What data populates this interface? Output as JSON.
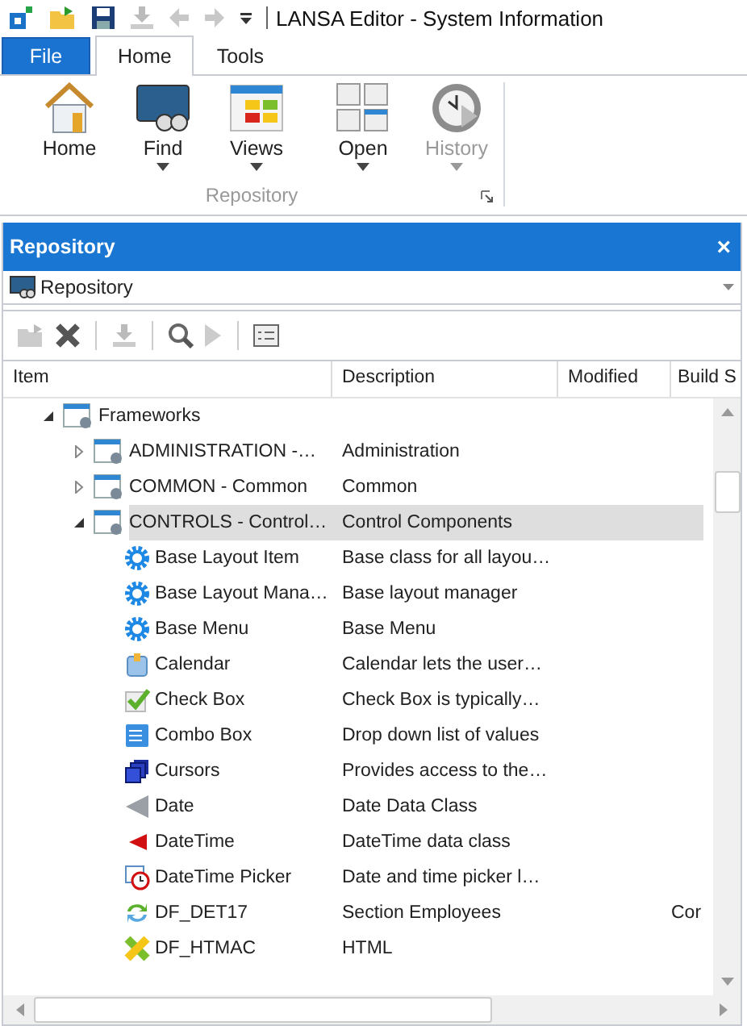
{
  "window": {
    "title": "LANSA Editor - System Information"
  },
  "ribbon_tabs": [
    {
      "label": "File",
      "kind": "file",
      "selected": false
    },
    {
      "label": "Home",
      "kind": "tab",
      "selected": true
    },
    {
      "label": "Tools",
      "kind": "tab",
      "selected": false
    }
  ],
  "ribbon_group": {
    "label": "Repository",
    "buttons": [
      {
        "label": "Home",
        "kind": "house",
        "dropdown": false,
        "disabled": false
      },
      {
        "label": "Find",
        "kind": "binoculars",
        "dropdown": true,
        "disabled": false
      },
      {
        "label": "Views",
        "kind": "views",
        "dropdown": true,
        "disabled": false
      },
      {
        "label": "Open",
        "kind": "open",
        "dropdown": true,
        "disabled": false
      },
      {
        "label": "History",
        "kind": "clock",
        "dropdown": true,
        "disabled": true
      }
    ]
  },
  "pane": {
    "title": "Repository",
    "close": "×",
    "selector": "Repository"
  },
  "table": {
    "columns": [
      "Item",
      "Description",
      "Modified",
      "Build S"
    ],
    "tree": [
      {
        "label": "Frameworks",
        "kind": "framework",
        "expanded": true,
        "selected": false,
        "children": [
          {
            "label": "ADMINISTRATION -…",
            "kind": "framework",
            "expanded": false,
            "selected": false,
            "description": "Administration"
          },
          {
            "label": "COMMON - Common",
            "kind": "framework",
            "expanded": false,
            "selected": false,
            "description": "Common"
          },
          {
            "label": "CONTROLS - Control…",
            "kind": "framework",
            "expanded": true,
            "selected": true,
            "description": "Control Components",
            "children": [
              {
                "label": "Base Layout Item",
                "kind": "gear",
                "selected": false,
                "description": "Base class for all layou…"
              },
              {
                "label": "Base Layout Mana…",
                "kind": "gear",
                "selected": false,
                "description": "Base layout manager"
              },
              {
                "label": "Base Menu",
                "kind": "gear",
                "selected": false,
                "description": "Base Menu"
              },
              {
                "label": "Calendar",
                "kind": "calendar",
                "selected": false,
                "description": "Calendar lets the user…"
              },
              {
                "label": "Check Box",
                "kind": "check",
                "selected": false,
                "description": "Check Box is typically…"
              },
              {
                "label": "Combo Box",
                "kind": "combo",
                "selected": false,
                "description": "Drop down list of values"
              },
              {
                "label": "Cursors",
                "kind": "cursors",
                "selected": false,
                "description": "Provides access to the…"
              },
              {
                "label": "Date",
                "kind": "date",
                "selected": false,
                "description": "Date Data Class"
              },
              {
                "label": "DateTime",
                "kind": "datetime",
                "selected": false,
                "description": "DateTime data class"
              },
              {
                "label": "DateTime Picker",
                "kind": "picker",
                "selected": false,
                "description": "Date and time picker l…"
              },
              {
                "label": "DF_DET17",
                "kind": "refresh",
                "selected": false,
                "description": "Section Employees",
                "column_4": "Cor"
              },
              {
                "label": "DF_HTMAC",
                "kind": "cross",
                "selected": false,
                "description": "HTML"
              }
            ]
          }
        ]
      }
    ]
  }
}
